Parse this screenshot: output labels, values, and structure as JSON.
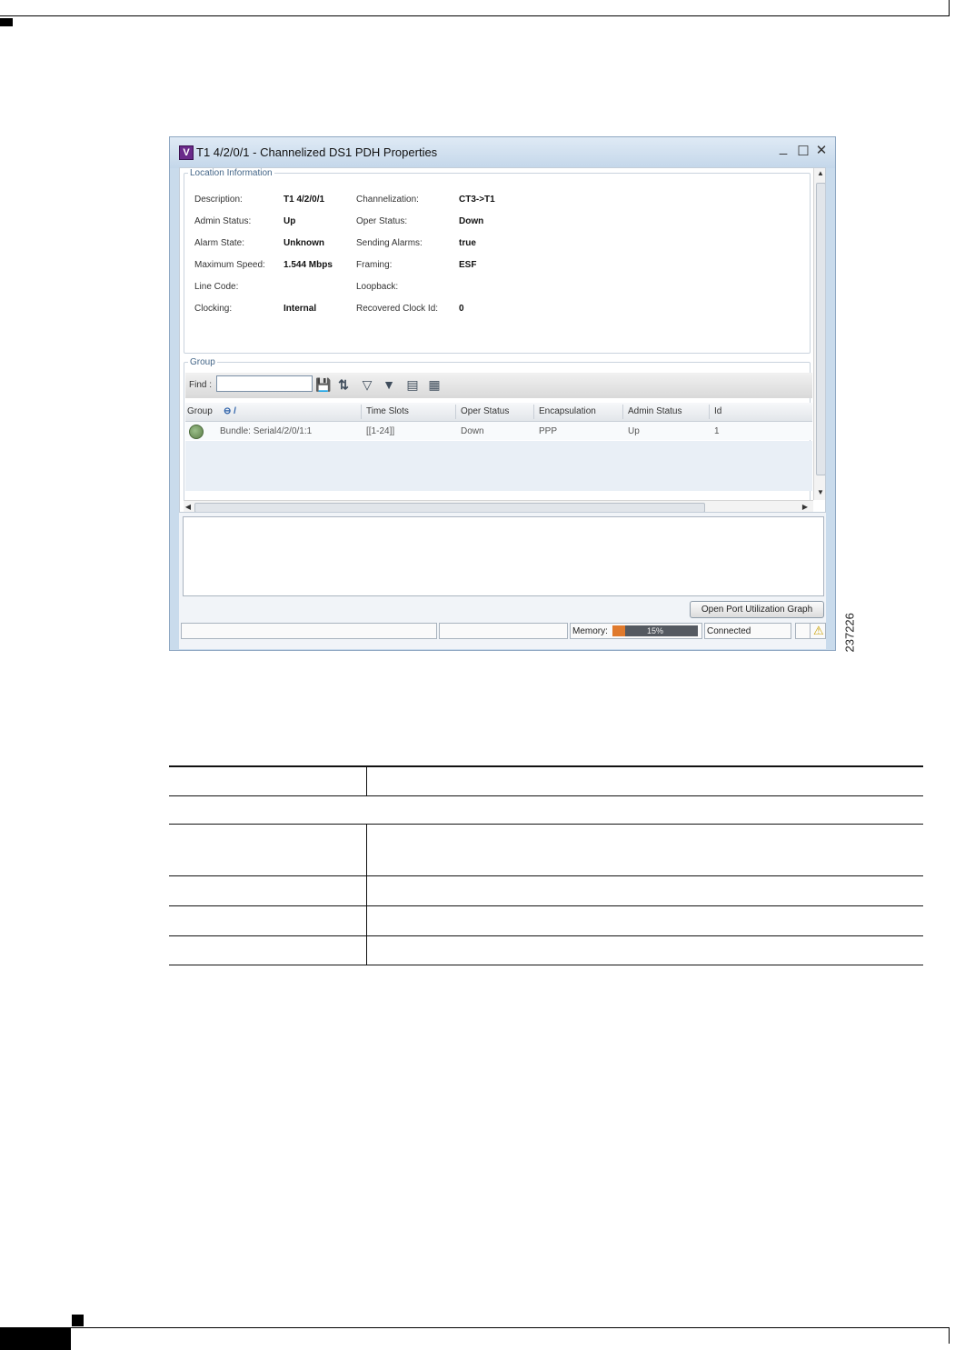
{
  "window": {
    "title": "T1 4/2/0/1 - Channelized DS1 PDH Properties",
    "icon_letter": "V",
    "controls": [
      "_",
      "☐",
      "✕"
    ]
  },
  "location_information": {
    "legend": "Location Information",
    "left": [
      {
        "label": "Description:",
        "value": "T1 4/2/0/1"
      },
      {
        "label": "Admin Status:",
        "value": "Up"
      },
      {
        "label": "Alarm State:",
        "value": "Unknown"
      },
      {
        "label": "Maximum Speed:",
        "value": "1.544 Mbps"
      },
      {
        "label": "Line Code:",
        "value": ""
      },
      {
        "label": "Clocking:",
        "value": "Internal"
      }
    ],
    "right": [
      {
        "label": "Channelization:",
        "value": "CT3->T1"
      },
      {
        "label": "Oper Status:",
        "value": "Down"
      },
      {
        "label": "Sending Alarms:",
        "value": "true"
      },
      {
        "label": "Framing:",
        "value": "ESF"
      },
      {
        "label": "Loopback:",
        "value": ""
      },
      {
        "label": "Recovered Clock Id:",
        "value": "0"
      }
    ]
  },
  "group": {
    "legend": "Group",
    "find_label": "Find :",
    "find_value": "",
    "toolbar_icons": [
      "save-icon",
      "sort-icon",
      "filter-icon",
      "filter-edit-icon",
      "export-icon",
      "export-all-icon"
    ],
    "columns": [
      "Group",
      "Time Slots",
      "Oper Status",
      "Encapsulation",
      "Admin Status",
      "Id"
    ],
    "group_header_icon": "⊖ /",
    "rows": [
      {
        "group": "Bundle: Serial4/2/0/1:1",
        "time_slots": "[[1-24]]",
        "oper_status": "Down",
        "encapsulation": "PPP",
        "admin_status": "Up",
        "id": "1"
      }
    ]
  },
  "buttons": {
    "open_graph": "Open Port Utilization Graph"
  },
  "status_bar": {
    "memory_label": "Memory:",
    "memory_percent_text": "15%",
    "memory_fraction": 0.15,
    "connection": "Connected"
  },
  "figure_id": "237226"
}
